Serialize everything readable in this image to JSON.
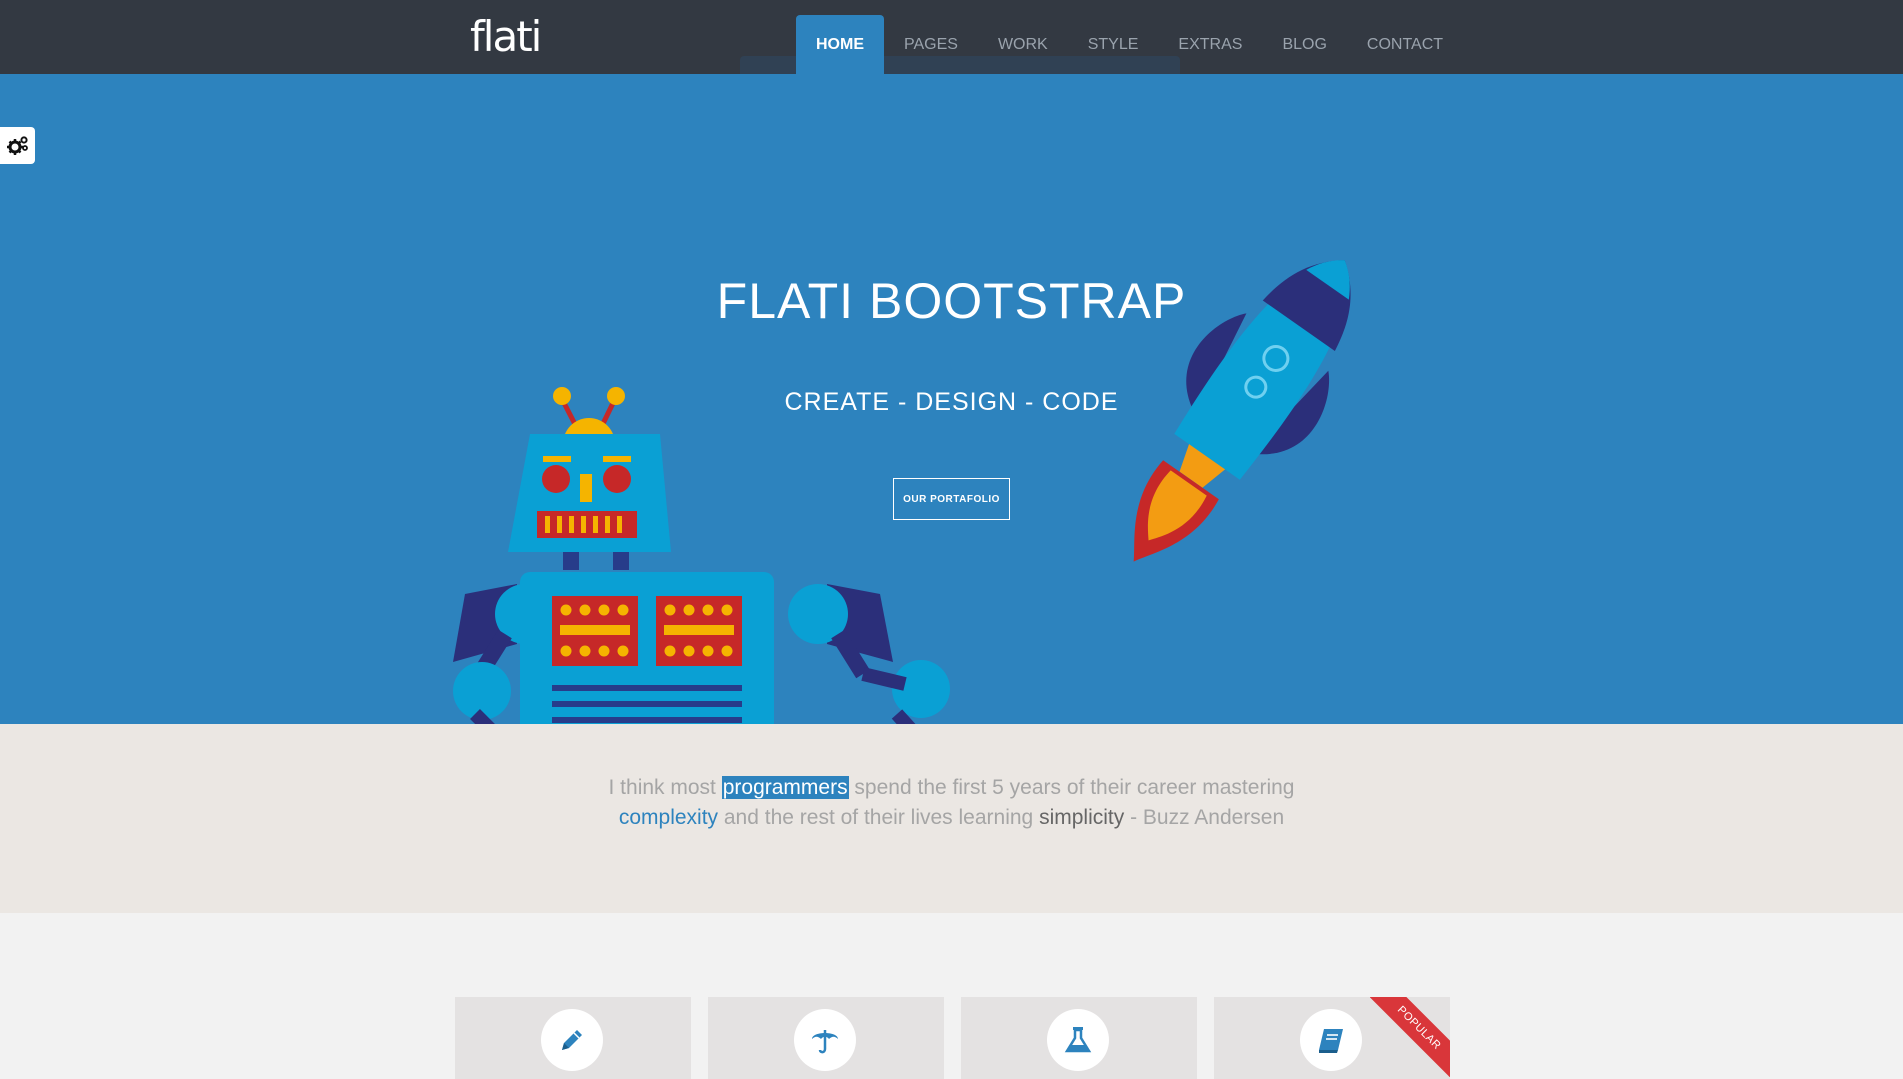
{
  "brand": "flati",
  "nav": {
    "items": [
      {
        "label": "HOME",
        "active": true
      },
      {
        "label": "PAGES",
        "active": false
      },
      {
        "label": "WORK",
        "active": false
      },
      {
        "label": "STYLE",
        "active": false
      },
      {
        "label": "EXTRAS",
        "active": false
      },
      {
        "label": "BLOG",
        "active": false
      },
      {
        "label": "CONTACT",
        "active": false
      }
    ]
  },
  "settings": {
    "icon": "gears-icon"
  },
  "hero": {
    "title": "FLATI BOOTSTRAP",
    "subtitle": "CREATE - DESIGN - CODE",
    "button_label": "OUR PORTAFOLIO"
  },
  "quote": {
    "part1": "I think most ",
    "highlight1": "programmers",
    "part2": " spend the first 5 years of their career mastering ",
    "highlight2": "complexity",
    "part3": " and the rest of their lives learning ",
    "highlight3": "simplicity",
    "part4": " - Buzz Andersen"
  },
  "features": {
    "cards": [
      {
        "icon": "pencil-icon"
      },
      {
        "icon": "umbrella-icon"
      },
      {
        "icon": "flask-icon"
      },
      {
        "icon": "book-icon",
        "ribbon": "POPULAR"
      }
    ]
  },
  "colors": {
    "navbar": "#333942",
    "accent": "#2d83be",
    "quote_bg": "#ebe7e3",
    "page_bg": "#f2f2f2",
    "ribbon": "#d9363a"
  }
}
